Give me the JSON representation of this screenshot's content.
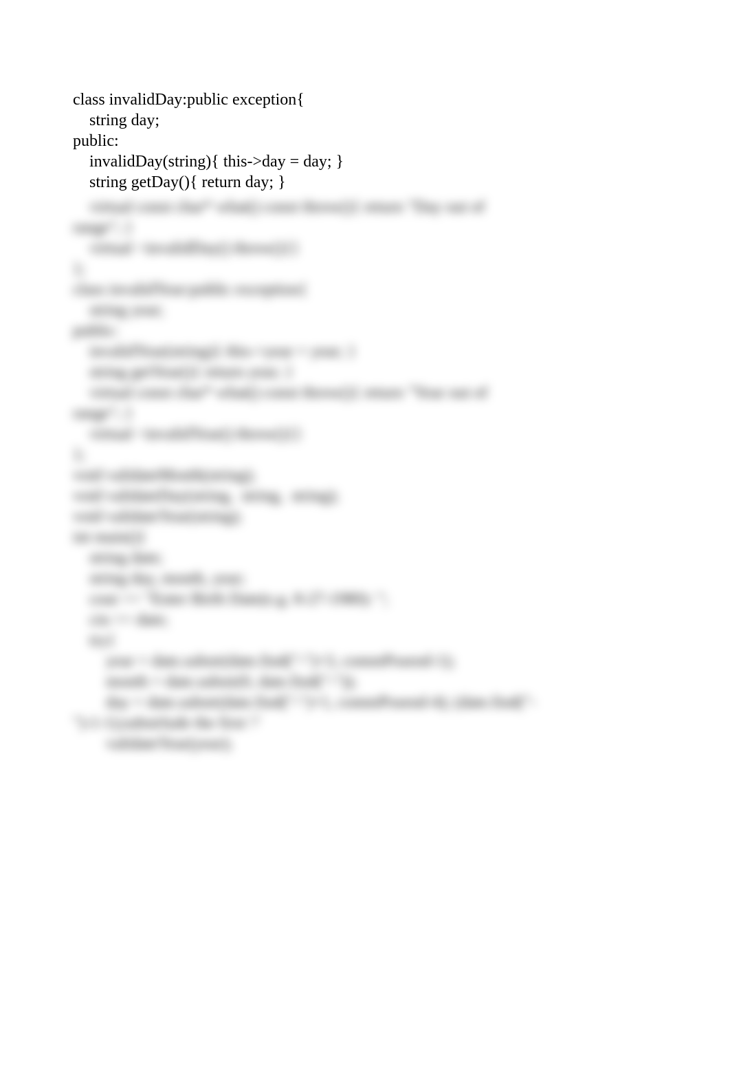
{
  "clear": {
    "lines": [
      "class invalidDay:public exception{",
      "    string day;",
      "public:",
      "    invalidDay(string){ this->day = day; }",
      "    string getDay(){ return day; }"
    ]
  },
  "blurred": {
    "lines": [
      "    virtual const char* what() const throw(){ return \"Day out of",
      "range\"; }",
      "    virtual ~invalidDay() throw(){}",
      "};",
      "",
      "class invalidYear:public exception{",
      "    string year;",
      "public:",
      "    invalidYear(string){ this->year = year; }",
      "    string getYear(){ return year; }",
      "    virtual const char* what() const throw(){ return \"Year out of",
      "range\"; }",
      "    virtual ~invalidYear() throw(){}",
      "};",
      "",
      "void validateMonth(string);",
      "void validateDay(string,  string,  string);",
      "void validateYear(string);",
      "",
      "int main(){",
      "",
      "    string date;",
      "    string day, month, year;",
      "",
      "    cout << \"Enter Birth Date(e.g. 8-27-1980): \";",
      "    cin >> date;",
      "",
      "    try{",
      "",
      "        year = date.substr(date.find(\"-\")+3, commPosend-1);",
      "        month = date.substr(0, date.find(\"-\"));",
      "        day = date.substr(date.find(\"-\")+1, commPosend-4); (date.find(\"-",
      "\")-1-1);substrlude the first '/'",
      "",
      "        validateYear(year);"
    ]
  }
}
